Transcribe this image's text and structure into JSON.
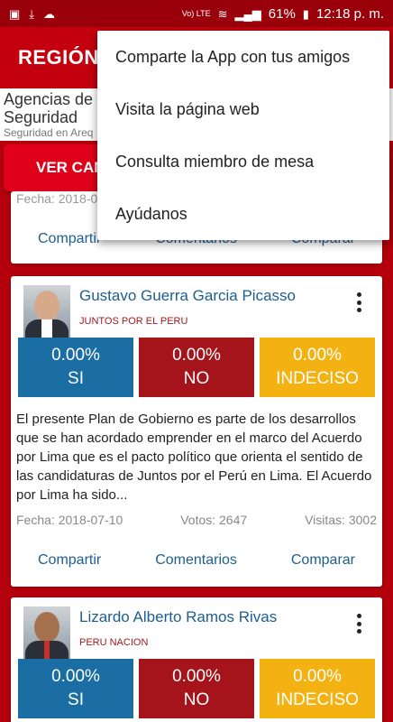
{
  "status_bar": {
    "battery": "61%",
    "time": "12:18 p. m.",
    "network": "Vo) LTE"
  },
  "app_bar": {
    "title": "REGIÓN"
  },
  "ad": {
    "line1": "Agencias de",
    "line2": "Seguridad",
    "line3": "Seguridad en Areq"
  },
  "ver_button": "VER CAN",
  "card0": {
    "fecha": "Fecha: 2018-0",
    "actions": {
      "share": "Compartir",
      "comments": "Comentarios",
      "compare": "Comparar"
    }
  },
  "candidates": [
    {
      "name": "Gustavo Guerra Garcia Picasso",
      "party": "JUNTOS POR EL PERU",
      "votes": [
        {
          "pct": "0.00%",
          "label": "SI"
        },
        {
          "pct": "0.00%",
          "label": "NO"
        },
        {
          "pct": "0.00%",
          "label": "INDECISO"
        }
      ],
      "description": "El presente Plan de Gobierno es parte de los desarrollos que se han acordado emprender en el marco del Acuerdo por Lima que es el pacto político que orienta el sentido de las candidaturas de Juntos por el Perú en Lima. El Acuerdo por Lima ha sido...",
      "fecha": "Fecha: 2018-07-10",
      "votos": "Votos: 2647",
      "visitas": "Visitas: 3002",
      "actions": {
        "share": "Compartir",
        "comments": "Comentarios",
        "compare": "Comparar"
      }
    },
    {
      "name": "Lizardo Alberto Ramos Rivas",
      "party": "PERU NACION",
      "votes": [
        {
          "pct": "0.00%",
          "label": "SI"
        },
        {
          "pct": "0.00%",
          "label": "NO"
        },
        {
          "pct": "0.00%",
          "label": "INDECISO"
        }
      ]
    }
  ],
  "menu": {
    "items": [
      "Comparte la App con tus amigos",
      "Visita la página web",
      "Consulta miembro de mesa",
      "Ayúdanos"
    ]
  }
}
